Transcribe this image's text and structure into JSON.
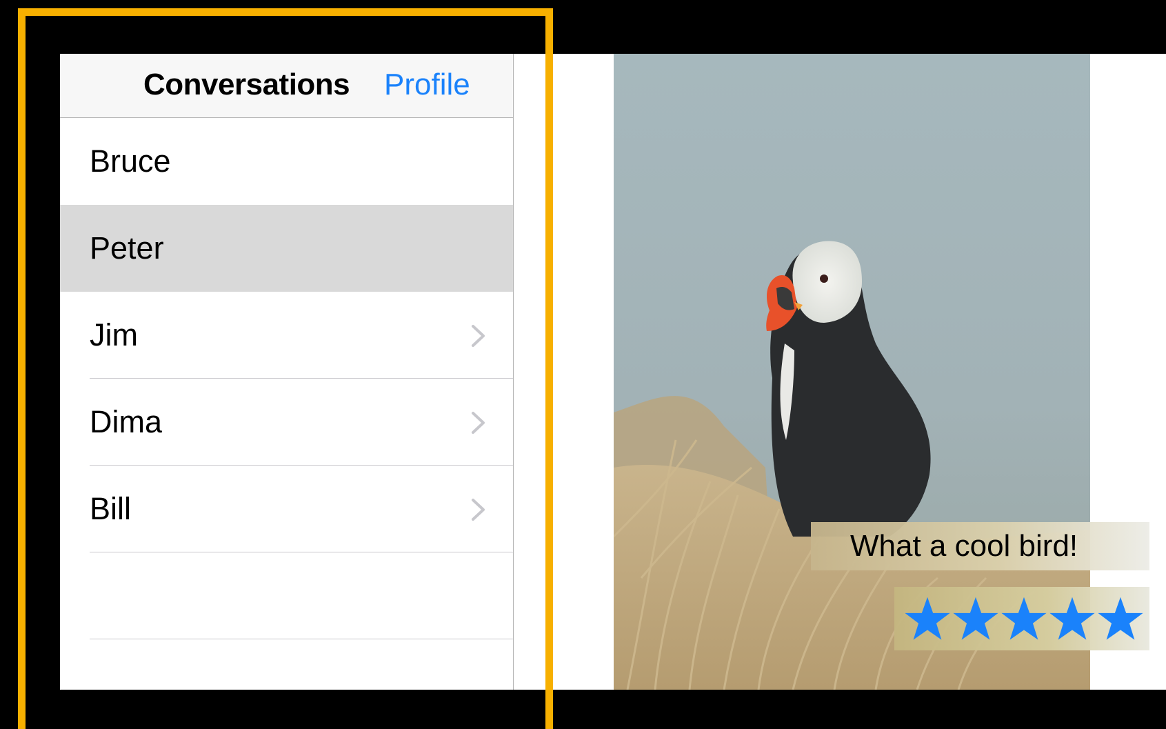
{
  "master": {
    "nav_title": "Conversations",
    "profile_label": "Profile",
    "conversations": [
      {
        "name": "Bruce",
        "selected": false,
        "chevron": false
      },
      {
        "name": "Peter",
        "selected": true,
        "chevron": false
      },
      {
        "name": "Jim",
        "selected": false,
        "chevron": true
      },
      {
        "name": "Dima",
        "selected": false,
        "chevron": true
      },
      {
        "name": "Bill",
        "selected": false,
        "chevron": true
      },
      {
        "name": "",
        "selected": false,
        "chevron": false
      }
    ]
  },
  "detail": {
    "photo_icon": "puffin-photo",
    "caption": "What a cool bird!",
    "rating": {
      "value": 5,
      "max": 5
    }
  },
  "colors": {
    "highlight_frame": "#F7B000",
    "tint": "#1a82fb",
    "selected_row": "#d9d9d9",
    "nav_bar": "#f7f7f7"
  }
}
